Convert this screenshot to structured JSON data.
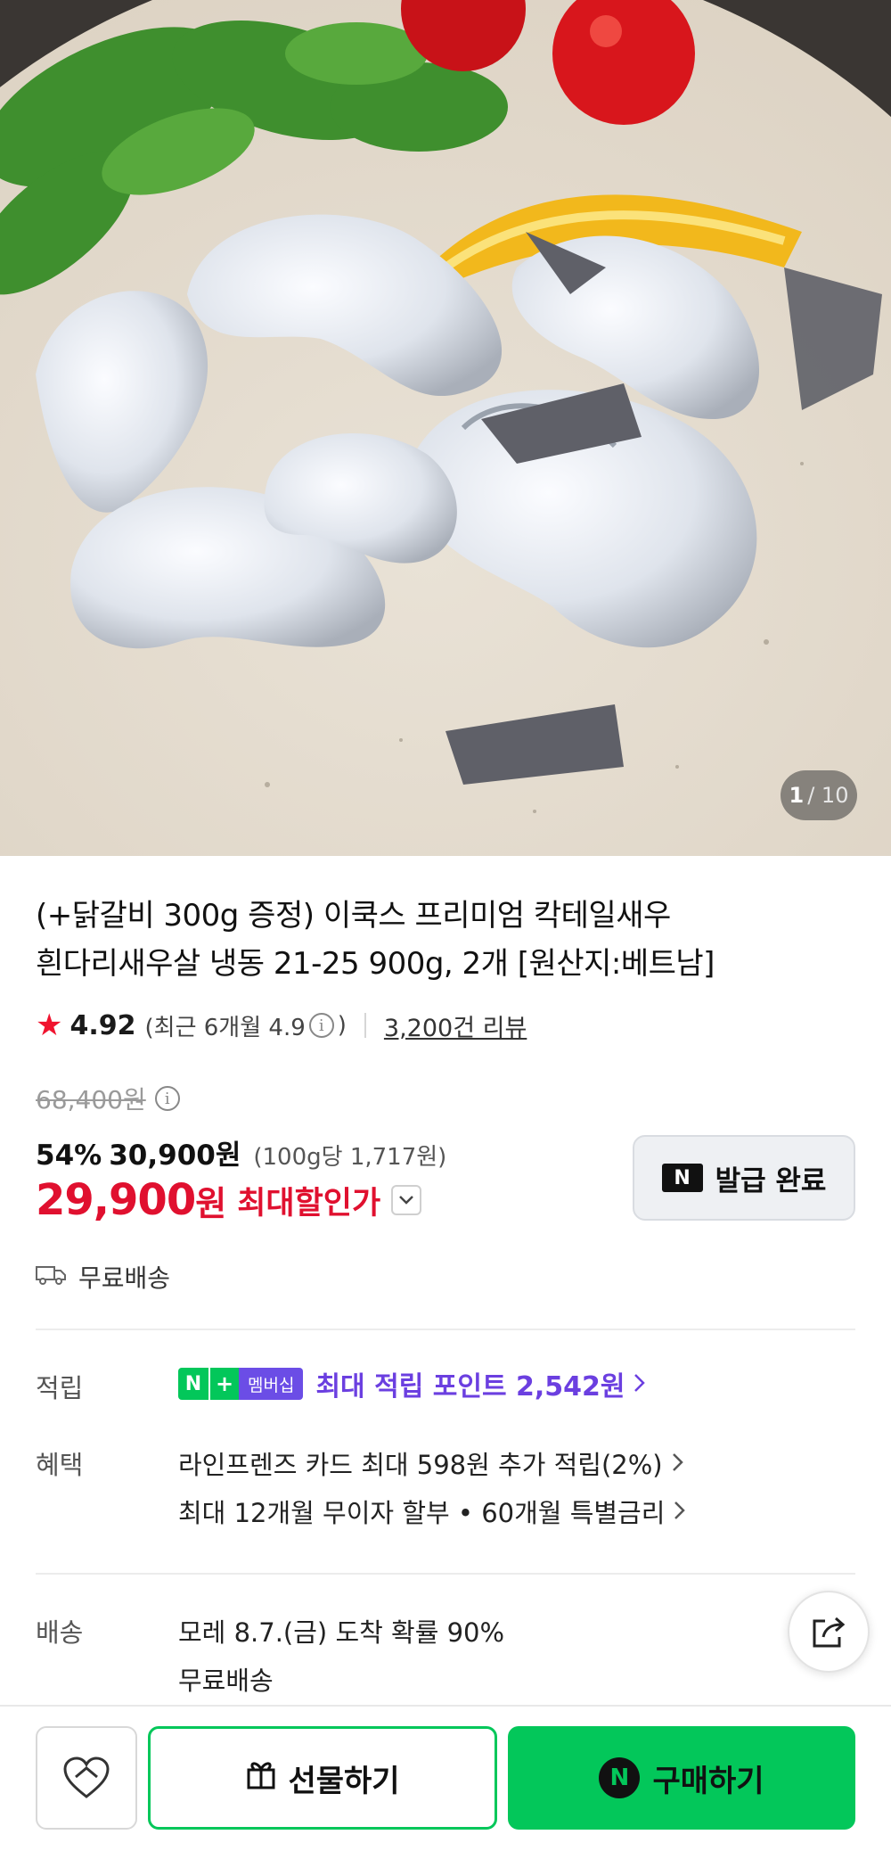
{
  "gallery": {
    "current": "1",
    "total": "/ 10"
  },
  "product": {
    "title_line1": "(+닭갈비 300g 증정) 이쿡스 프리미엄 칵테일새우",
    "title_line2": "흰다리새우살 냉동 21-25 900g, 2개 [원산지:베트남]"
  },
  "rating": {
    "score": "4.92",
    "recent_prefix": "(최근 6개월 4.9",
    "recent_suffix": ")",
    "review_count": "3,200건 리뷰"
  },
  "price": {
    "original": "68,400원",
    "discount_pct": "54%",
    "sale": "30,900원",
    "unit_price": "(100g당 1,717원)",
    "max_discount_price": "29,900",
    "max_discount_won": "원",
    "max_discount_label": "최대할인가"
  },
  "coupon": {
    "label": "발급 완료",
    "badge": "N"
  },
  "shipping_short": "무료배송",
  "benefits": {
    "points_label": "적립",
    "membership_n": "N",
    "membership_plus": "+",
    "membership_name": "멤버십",
    "points_text": "최대 적립 포인트 2,542원",
    "benefit_label": "혜택",
    "benefit_line1": "라인프렌즈 카드 최대 598원 추가 적립(2%)",
    "benefit_line2": "최대 12개월 무이자 할부 • 60개월 특별금리"
  },
  "delivery": {
    "label": "배송",
    "eta": "모레 8.7.(금) 도착 확률 90%",
    "fee": "무료배송"
  },
  "actions": {
    "gift": "선물하기",
    "buy": "구매하기",
    "buy_badge": "N"
  },
  "colors": {
    "accent_red": "#e0102f",
    "naver_green": "#03c75a",
    "membership_purple": "#6b3fe0"
  }
}
